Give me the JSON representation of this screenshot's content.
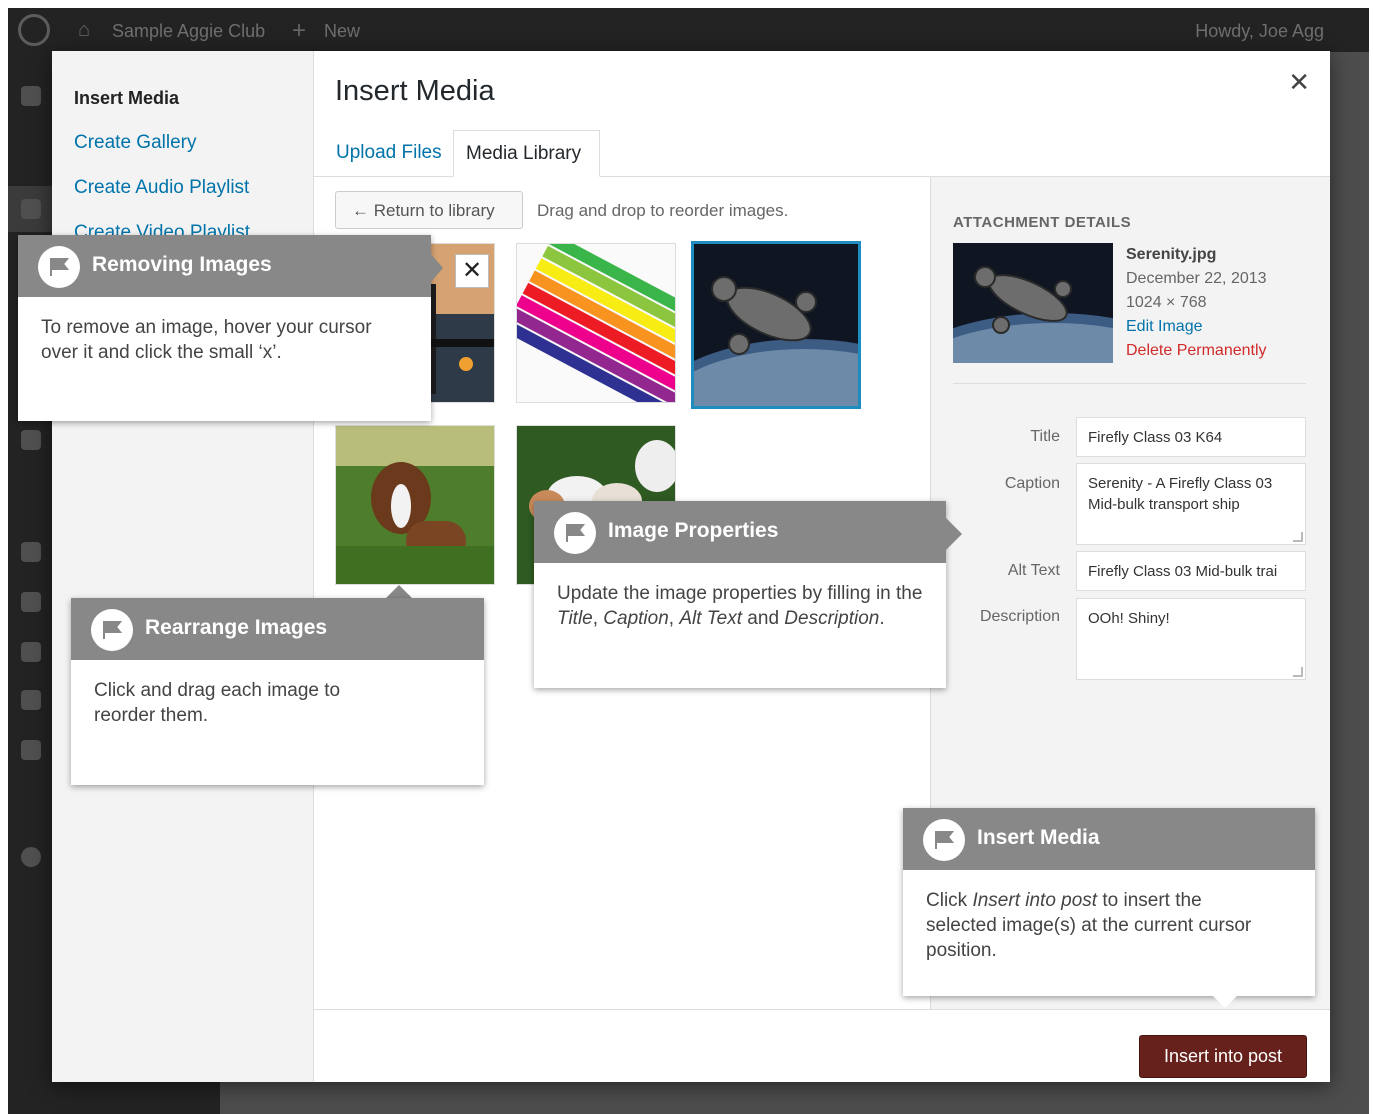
{
  "adminbar": {
    "site_name": "Sample Aggie Club",
    "new_label": "New",
    "howdy": "Howdy, Joe Agg"
  },
  "menu": {
    "items": [
      "Insert Media",
      "Create Gallery",
      "Create Audio Playlist",
      "Create Video Playlist"
    ]
  },
  "modal": {
    "title": "Insert Media",
    "close_icon": "close-icon",
    "tabs": [
      "Upload Files",
      "Media Library"
    ],
    "return_button": "← Return to library",
    "drag_hint": "Drag and drop to reorder images.",
    "thumb_remove": "✕"
  },
  "attachment": {
    "header": "ATTACHMENT DETAILS",
    "filename": "Serenity.jpg",
    "date": "December 22, 2013",
    "dimensions": "1024 × 768",
    "edit_link": "Edit Image",
    "delete_link": "Delete Permanently",
    "fields": {
      "title_label": "Title",
      "title_value": "Firefly Class 03 K64",
      "caption_label": "Caption",
      "caption_value": "Serenity - A Firefly Class 03 Mid-bulk transport ship",
      "alt_label": "Alt Text",
      "alt_value": "Firefly Class 03 Mid-bulk trai",
      "description_label": "Description",
      "description_value": "OOh! Shiny!"
    }
  },
  "toolbar": {
    "insert_button": "Insert into post"
  },
  "callouts": {
    "removing": {
      "title": "Removing Images",
      "text": "To remove an image, hover your cursor over it and click the small ‘x’."
    },
    "rearrange": {
      "title": "Rearrange Images",
      "text": "Click and drag each image to reorder them."
    },
    "properties": {
      "title": "Image Properties",
      "text_a": "Update the image properties by filling in the ",
      "text_title": "Title",
      "text_comma1": ", ",
      "text_caption": "Caption",
      "text_comma2": ", ",
      "text_alt": "Alt Text",
      "text_and": " and ",
      "text_desc": "Description",
      "text_end": "."
    },
    "insert": {
      "title": "Insert Media",
      "text_a": "Click ",
      "text_em": "Insert into post",
      "text_b": " to insert the selected image(s) at the current cursor position."
    }
  },
  "colors": {
    "accent": "#0073aa",
    "insert_button": "#66211c",
    "callout_header": "#888888",
    "selected_border": "#1e8cbe"
  }
}
